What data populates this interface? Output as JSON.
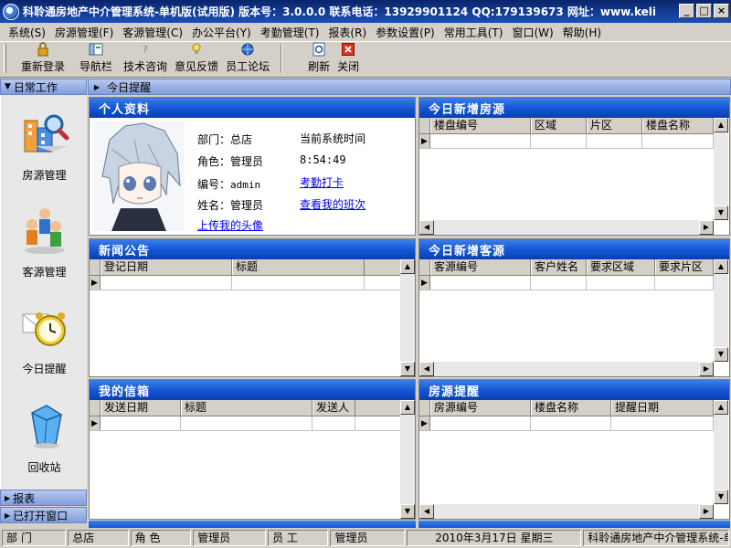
{
  "window": {
    "title": "科聆通房地产中介管理系统-单机版(试用版) 版本号：3.0.0.0 联系电话：13929901124 QQ:179139673 网址：www.keli",
    "buttons": [
      "_",
      "□",
      "×"
    ]
  },
  "menu": [
    "系统(S)",
    "房源管理(F)",
    "客源管理(C)",
    "办公平台(Y)",
    "考勤管理(T)",
    "报表(R)",
    "参数设置(P)",
    "常用工具(T)",
    "窗口(W)",
    "帮助(H)"
  ],
  "toolbar": {
    "relogin": "重新登录",
    "navbar": "导航栏",
    "tech_consult": "技术咨询",
    "feedback": "意见反馈",
    "forum": "员工论坛",
    "refresh": "刷新",
    "close": "关闭"
  },
  "sidebar": {
    "header": "日常工作",
    "items": [
      {
        "label": "房源管理",
        "icon": "house-search-icon"
      },
      {
        "label": "客源管理",
        "icon": "people-icon"
      },
      {
        "label": "今日提醒",
        "icon": "alarm-clock-icon"
      },
      {
        "label": "回收站",
        "icon": "recycle-bin-icon"
      }
    ],
    "footer_reports": "报表",
    "footer_windows": "已打开窗口"
  },
  "main": {
    "header": "今日提醒"
  },
  "profile": {
    "title": "个人资料",
    "dept_label": "部门：",
    "dept": "总店",
    "role_label": "角色：",
    "role": "管理员",
    "id_label": "编号：",
    "id": "admin",
    "name_label": "姓名：",
    "name": "管理员",
    "upload_avatar": "上传我的头像",
    "time_label": "当前系统时间",
    "time": "8:54:49",
    "clock_in": "考勤打卡",
    "view_shifts": "查看我的班次"
  },
  "new_houses": {
    "title": "今日新增房源",
    "columns": [
      "楼盘编号",
      "区域",
      "片区",
      "楼盘名称"
    ]
  },
  "news": {
    "title": "新闻公告",
    "columns": [
      "登记日期",
      "标题"
    ]
  },
  "new_clients": {
    "title": "今日新增客源",
    "columns": [
      "客源编号",
      "客户姓名",
      "要求区域",
      "要求片区"
    ]
  },
  "mailbox": {
    "title": "我的信箱",
    "columns": [
      "发送日期",
      "标题",
      "发送人"
    ]
  },
  "house_reminder": {
    "title": "房源提醒",
    "columns": [
      "房源编号",
      "楼盘名称",
      "提醒日期"
    ]
  },
  "status": {
    "dept_label": "部 门",
    "dept": "总店",
    "role_label": "角 色",
    "role": "管理员",
    "staff_label": "员 工",
    "staff": "管理员",
    "date": "2010年3月17日 星期三",
    "app": "科聆通房地产中介管理系统-单机版"
  },
  "colors": {
    "panel_title": "#1557d6",
    "titlebar": "#0a246a",
    "link": "#0000ee"
  }
}
